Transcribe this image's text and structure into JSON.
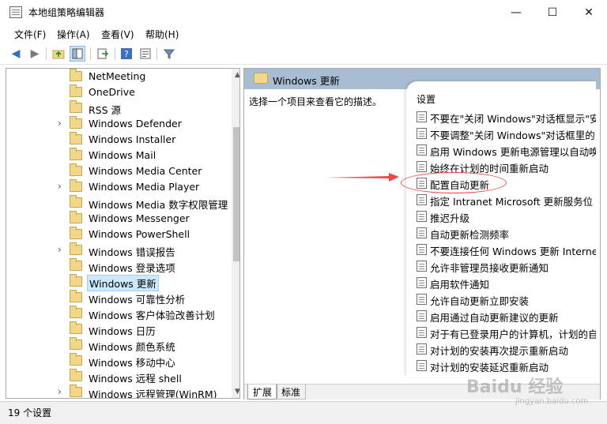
{
  "window": {
    "title": "本地组策略编辑器",
    "min": "—",
    "max": "☐",
    "close": "✕"
  },
  "menu": [
    "文件(F)",
    "操作(A)",
    "查看(V)",
    "帮助(H)"
  ],
  "tree": {
    "items": [
      {
        "label": "NetMeeting",
        "expandable": false
      },
      {
        "label": "OneDrive",
        "expandable": false
      },
      {
        "label": "RSS 源",
        "expandable": false
      },
      {
        "label": "Windows Defender",
        "expandable": true
      },
      {
        "label": "Windows Installer",
        "expandable": false
      },
      {
        "label": "Windows Mail",
        "expandable": false
      },
      {
        "label": "Windows Media Center",
        "expandable": false
      },
      {
        "label": "Windows Media Player",
        "expandable": true
      },
      {
        "label": "Windows Media 数字权限管理",
        "expandable": false
      },
      {
        "label": "Windows Messenger",
        "expandable": false
      },
      {
        "label": "Windows PowerShell",
        "expandable": false
      },
      {
        "label": "Windows 错误报告",
        "expandable": true
      },
      {
        "label": "Windows 登录选项",
        "expandable": false
      },
      {
        "label": "Windows 更新",
        "expandable": false,
        "selected": true
      },
      {
        "label": "Windows 可靠性分析",
        "expandable": false
      },
      {
        "label": "Windows 客户体验改善计划",
        "expandable": false
      },
      {
        "label": "Windows 日历",
        "expandable": false
      },
      {
        "label": "Windows 颜色系统",
        "expandable": false
      },
      {
        "label": "Windows 移动中心",
        "expandable": false
      },
      {
        "label": "Windows 远程 shell",
        "expandable": false
      },
      {
        "label": "Windows 远程管理(WinRM)",
        "expandable": true
      }
    ]
  },
  "right": {
    "header": "Windows 更新",
    "description": "选择一个项目来查看它的描述。",
    "settings_header": "设置",
    "settings": [
      "不要在\"关闭 Windows\"对话框显示\"安",
      "不要调整\"关闭 Windows\"对话框里的",
      "启用 Windows 更新电源管理以自动唤",
      "始终在计划的时间重新启动",
      "配置自动更新",
      "指定 Intranet Microsoft 更新服务位",
      "推迟升级",
      "自动更新检测频率",
      "不要连接任何 Windows 更新 Interne",
      "允许非管理员接收更新通知",
      "启用软件通知",
      "允许自动更新立即安装",
      "启用通过自动更新建议的更新",
      "对于有已登录用户的计算机，计划的自",
      "对计划的安装再次提示重新启动",
      "对计划的安装延迟重新启动"
    ]
  },
  "tabs": {
    "extended": "扩展",
    "standard": "标准"
  },
  "status": {
    "text": "19 个设置"
  },
  "watermark": {
    "main": "Baidu 经验",
    "sub": "jingyan.baidu.com"
  },
  "colors": {
    "selection": "#cce8ff",
    "header": "#a8bdd3",
    "annotation": "#e84a4a"
  }
}
